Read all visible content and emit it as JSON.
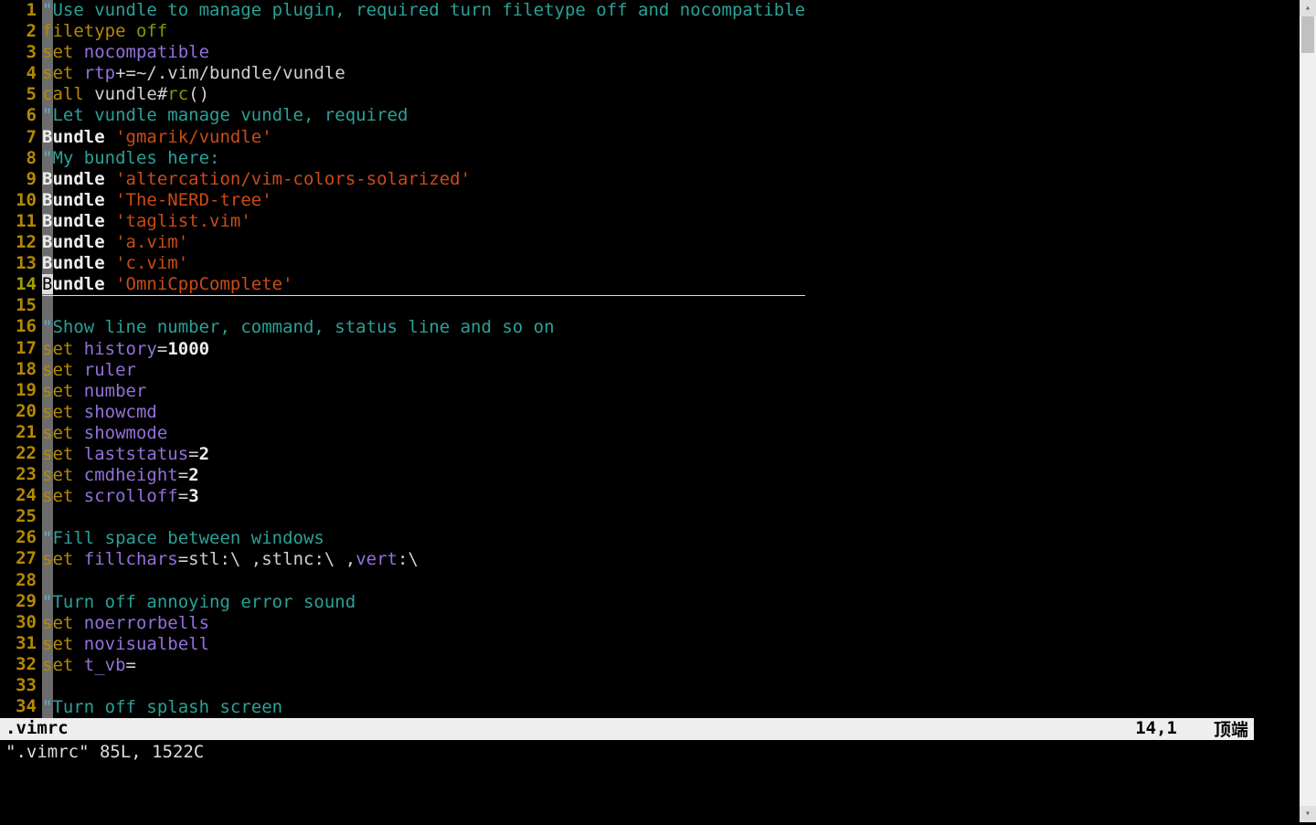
{
  "file": {
    "name": ".vimrc",
    "info_line": "\".vimrc\" 85L, 1522C"
  },
  "status": {
    "filename": ".vimrc",
    "cursor_pos": "14,1",
    "scroll_label": "顶端"
  },
  "cursor": {
    "line": 14,
    "col": 1
  },
  "lines": [
    {
      "n": 1,
      "tokens": [
        [
          "quote",
          "\""
        ],
        [
          "comment",
          "Use vundle to manage plugin, required turn filetype off and nocompatible"
        ]
      ]
    },
    {
      "n": 2,
      "tokens": [
        [
          "key",
          "filetype"
        ],
        [
          "text",
          " "
        ],
        [
          "green",
          "off"
        ]
      ]
    },
    {
      "n": 3,
      "tokens": [
        [
          "key",
          "set"
        ],
        [
          "text",
          " "
        ],
        [
          "opt",
          "nocompatible"
        ]
      ]
    },
    {
      "n": 4,
      "tokens": [
        [
          "key",
          "set"
        ],
        [
          "text",
          " "
        ],
        [
          "opt",
          "rtp"
        ],
        [
          "text",
          "+=~/.vim/bundle/vundle"
        ]
      ]
    },
    {
      "n": 5,
      "tokens": [
        [
          "key",
          "call"
        ],
        [
          "text",
          " vundle#"
        ],
        [
          "green",
          "rc"
        ],
        [
          "text",
          "()"
        ]
      ]
    },
    {
      "n": 6,
      "tokens": [
        [
          "quote",
          "\""
        ],
        [
          "comment",
          "Let vundle manage vundle, required"
        ]
      ]
    },
    {
      "n": 7,
      "tokens": [
        [
          "white",
          "Bundle"
        ],
        [
          "text",
          " "
        ],
        [
          "string",
          "'gmarik/vundle'"
        ]
      ]
    },
    {
      "n": 8,
      "tokens": [
        [
          "quote",
          "\""
        ],
        [
          "comment",
          "My bundles here:"
        ]
      ]
    },
    {
      "n": 9,
      "tokens": [
        [
          "white",
          "Bundle"
        ],
        [
          "text",
          " "
        ],
        [
          "string",
          "'altercation/vim-colors-solarized'"
        ]
      ]
    },
    {
      "n": 10,
      "tokens": [
        [
          "white",
          "Bundle"
        ],
        [
          "text",
          " "
        ],
        [
          "string",
          "'The-NERD-tree'"
        ]
      ]
    },
    {
      "n": 11,
      "tokens": [
        [
          "white",
          "Bundle"
        ],
        [
          "text",
          " "
        ],
        [
          "string",
          "'taglist.vim'"
        ]
      ]
    },
    {
      "n": 12,
      "tokens": [
        [
          "white",
          "Bundle"
        ],
        [
          "text",
          " "
        ],
        [
          "string",
          "'a.vim'"
        ]
      ]
    },
    {
      "n": 13,
      "tokens": [
        [
          "white",
          "Bundle"
        ],
        [
          "text",
          " "
        ],
        [
          "string",
          "'c.vim'"
        ]
      ]
    },
    {
      "n": 14,
      "tokens": [
        [
          "white",
          "Bundle"
        ],
        [
          "text",
          " "
        ],
        [
          "string",
          "'OmniCppComplete'"
        ]
      ],
      "current": true
    },
    {
      "n": 15,
      "tokens": []
    },
    {
      "n": 16,
      "tokens": [
        [
          "quote",
          "\""
        ],
        [
          "comment",
          "Show line number, command, status line and so on"
        ]
      ]
    },
    {
      "n": 17,
      "tokens": [
        [
          "key",
          "set"
        ],
        [
          "text",
          " "
        ],
        [
          "opt",
          "history"
        ],
        [
          "text",
          "="
        ],
        [
          "white",
          "1000"
        ]
      ]
    },
    {
      "n": 18,
      "tokens": [
        [
          "key",
          "set"
        ],
        [
          "text",
          " "
        ],
        [
          "opt",
          "ruler"
        ]
      ]
    },
    {
      "n": 19,
      "tokens": [
        [
          "key",
          "set"
        ],
        [
          "text",
          " "
        ],
        [
          "opt",
          "number"
        ]
      ]
    },
    {
      "n": 20,
      "tokens": [
        [
          "key",
          "set"
        ],
        [
          "text",
          " "
        ],
        [
          "opt",
          "showcmd"
        ]
      ]
    },
    {
      "n": 21,
      "tokens": [
        [
          "key",
          "set"
        ],
        [
          "text",
          " "
        ],
        [
          "opt",
          "showmode"
        ]
      ]
    },
    {
      "n": 22,
      "tokens": [
        [
          "key",
          "set"
        ],
        [
          "text",
          " "
        ],
        [
          "opt",
          "laststatus"
        ],
        [
          "text",
          "="
        ],
        [
          "white",
          "2"
        ]
      ]
    },
    {
      "n": 23,
      "tokens": [
        [
          "key",
          "set"
        ],
        [
          "text",
          " "
        ],
        [
          "opt",
          "cmdheight"
        ],
        [
          "text",
          "="
        ],
        [
          "white",
          "2"
        ]
      ]
    },
    {
      "n": 24,
      "tokens": [
        [
          "key",
          "set"
        ],
        [
          "text",
          " "
        ],
        [
          "opt",
          "scrolloff"
        ],
        [
          "text",
          "="
        ],
        [
          "white",
          "3"
        ]
      ]
    },
    {
      "n": 25,
      "tokens": []
    },
    {
      "n": 26,
      "tokens": [
        [
          "quote",
          "\""
        ],
        [
          "comment",
          "Fill space between windows"
        ]
      ]
    },
    {
      "n": 27,
      "tokens": [
        [
          "key",
          "set"
        ],
        [
          "text",
          " "
        ],
        [
          "opt",
          "fillchars"
        ],
        [
          "text",
          "=stl:\\ ,stlnc:\\ ,"
        ],
        [
          "opt",
          "vert"
        ],
        [
          "text",
          ":\\ "
        ]
      ]
    },
    {
      "n": 28,
      "tokens": []
    },
    {
      "n": 29,
      "tokens": [
        [
          "quote",
          "\""
        ],
        [
          "comment",
          "Turn off annoying error sound"
        ]
      ]
    },
    {
      "n": 30,
      "tokens": [
        [
          "key",
          "set"
        ],
        [
          "text",
          " "
        ],
        [
          "opt",
          "noerrorbells"
        ]
      ]
    },
    {
      "n": 31,
      "tokens": [
        [
          "key",
          "set"
        ],
        [
          "text",
          " "
        ],
        [
          "opt",
          "novisualbell"
        ]
      ]
    },
    {
      "n": 32,
      "tokens": [
        [
          "key",
          "set"
        ],
        [
          "text",
          " "
        ],
        [
          "opt",
          "t_vb"
        ],
        [
          "text",
          "="
        ]
      ]
    },
    {
      "n": 33,
      "tokens": []
    },
    {
      "n": 34,
      "tokens": [
        [
          "quote",
          "\""
        ],
        [
          "comment",
          "Turn off splash screen"
        ]
      ]
    }
  ]
}
